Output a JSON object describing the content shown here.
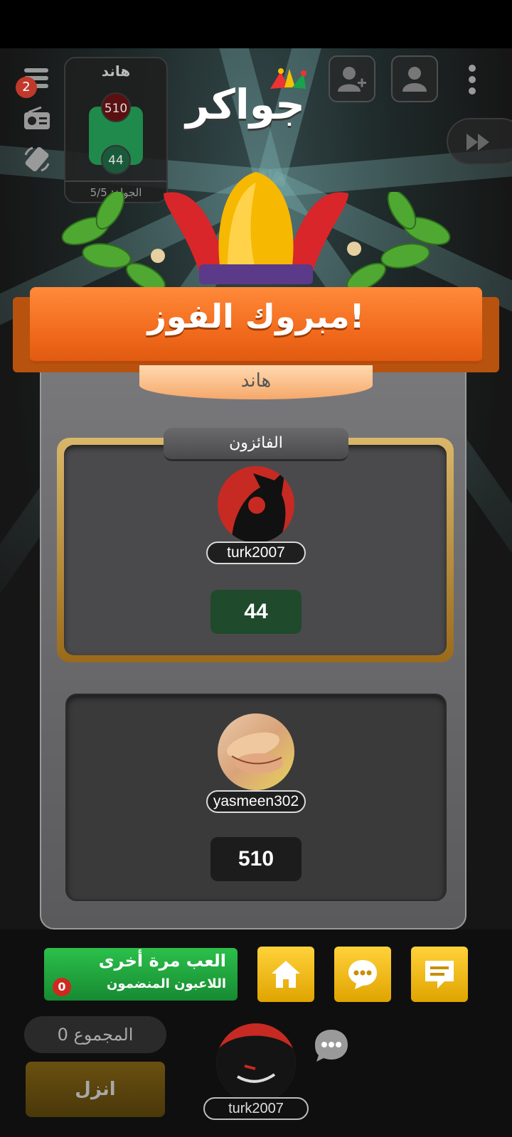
{
  "top": {
    "logo_text": "جواكر",
    "menu_badge": "2",
    "mini_scoreboard": {
      "title": "هاند",
      "score_top": "510",
      "score_bottom": "44",
      "round_label": "الجولة: 5/5"
    }
  },
  "result": {
    "banner_title": "مبروك الفوز!",
    "game_mode": "هاند",
    "winners_label": "الفائزون",
    "winner": {
      "name": "turk2007",
      "score": "44"
    },
    "loser": {
      "name": "yasmeen302",
      "score": "510"
    }
  },
  "actions": {
    "play_again_label": "العب مرة أخرى",
    "joined_players_label": "اللاعبون المنضمون",
    "joined_count": "0"
  },
  "bottom": {
    "total_label": "المجموع 0",
    "drop_label": "انزل",
    "player_name": "turk2007"
  },
  "colors": {
    "accent_orange": "#f26b1d",
    "winner_score_bg": "#1f4a2b",
    "gold_frame": "#c9962e",
    "green_button": "#1fa23c",
    "yellow_button": "#f2b705"
  }
}
